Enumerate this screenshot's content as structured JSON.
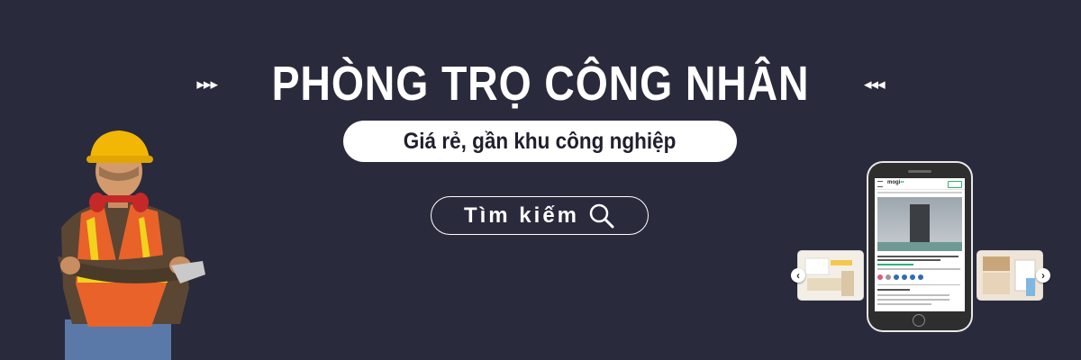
{
  "banner": {
    "title": "PHÒNG TRỌ CÔNG NHÂN",
    "left_arrows": "▸▸▸",
    "right_arrows": "◂◂◂",
    "subtitle": "Giá rẻ, gần khu công nghiệp",
    "search_button_label": "Tìm kiếm",
    "search_icon": "search-icon"
  },
  "phone": {
    "logo": "mogi"
  },
  "colors": {
    "background": "#2a2a3d",
    "text": "#ffffff",
    "pill": "#ffffff",
    "brand_green": "#2ab27b",
    "helmet_yellow": "#f2b705",
    "vest_orange": "#e8622a"
  }
}
